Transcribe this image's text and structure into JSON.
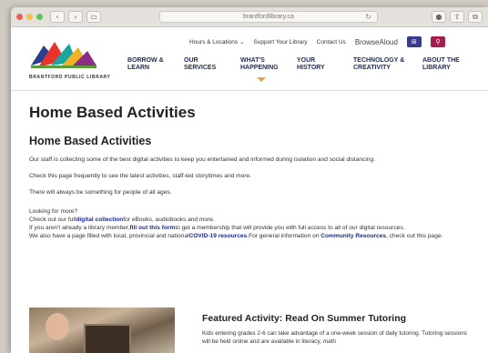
{
  "browser": {
    "url": "brantfordlibrary.ca",
    "reload_glyph": "↻",
    "back_glyph": "‹",
    "forward_glyph": "›",
    "sidebar_glyph": "▭",
    "right_icons": [
      "●",
      "⇧",
      "⧉"
    ],
    "colors": {
      "close": "#ee5e57",
      "minimize": "#f4bd4f",
      "zoom": "#5ec456"
    }
  },
  "header": {
    "logo_text": "BRANTFORD PUBLIC LIBRARY",
    "util_links": [
      "Hours & Locations",
      "Support Your Library",
      "Contact Us"
    ],
    "util_chevron": "⌄",
    "browsealoud": "BrowseAloud",
    "util_buttons": [
      {
        "glyph": "⊞",
        "color": "#3a3a8c"
      },
      {
        "glyph": "⚲",
        "color": "#a51e4f"
      }
    ],
    "nav": [
      {
        "label": "BORROW &\nLEARN"
      },
      {
        "label": "OUR\nSERVICES"
      },
      {
        "label": "WHAT'S\nHAPPENING"
      },
      {
        "label": "YOUR\nHISTORY"
      },
      {
        "label": "TECHNOLOGY &\nCREATIVITY"
      },
      {
        "label": "ABOUT THE\nLIBRARY"
      }
    ],
    "accent_color": "#e8a13a"
  },
  "main": {
    "page_title": "Home Based Activities",
    "section_title": "Home Based Activities",
    "p1": "Our staff is collecting some of the best digital activities to keep you entertained and informed during isolation and social distancing.",
    "p2": "Check this page frequently to see the latest activities, staff-led storytimes and more.",
    "p3": "There will always be something for people of all ages.",
    "looking": "Looking for more?",
    "check_pre": "Check out our full",
    "check_link": "digital collection",
    "check_post": "for eBooks, audiobooks and more.",
    "member_pre": "If you aren't already a library member,",
    "member_link": "fill out this form",
    "member_post": "to get a membership that will provide you with full access to all of our digital resources.",
    "also_pre": "We also have a page filled with local, provincial and national",
    "also_link": "COVID-19 resources",
    "also_mid": ".For general information on ",
    "also_link2": "Community Resources",
    "also_post": ", check out this page."
  },
  "featured": {
    "title": "Featured Activity: Read On Summer Tutoring",
    "text": "Kids entering grades 2-6 can take advantage of a one-week session of daily tutoring. Tutoring sessions will be held online and are available in literacy, math"
  }
}
